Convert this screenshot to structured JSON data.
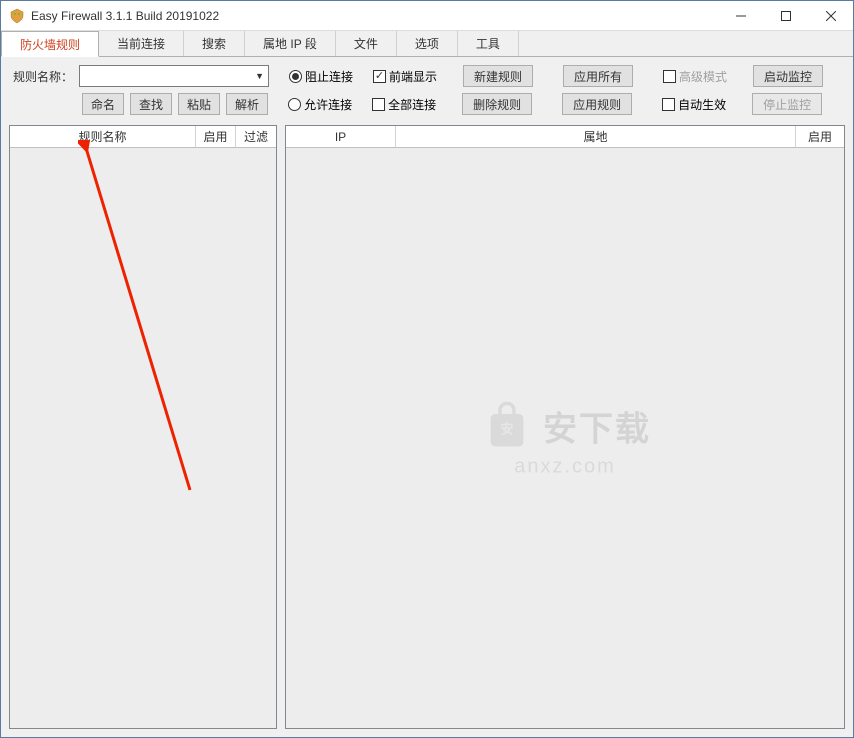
{
  "window": {
    "title": "Easy Firewall 3.1.1 Build 20191022"
  },
  "tabs": {
    "items": [
      {
        "label": "防火墙规则",
        "active": true
      },
      {
        "label": "当前连接",
        "active": false
      },
      {
        "label": "搜索",
        "active": false
      },
      {
        "label": "属地 IP 段",
        "active": false
      },
      {
        "label": "文件",
        "active": false
      },
      {
        "label": "选项",
        "active": false
      },
      {
        "label": "工具",
        "active": false
      }
    ]
  },
  "toolbar": {
    "rule_name_label": "规则名称：",
    "buttons": {
      "rename": "命名",
      "find": "查找",
      "paste": "粘贴",
      "parse": "解析",
      "new_rule": "新建规则",
      "apply_all": "应用所有",
      "advanced_mode": "高级模式",
      "start_monitor": "启动监控",
      "delete_rule": "删除规则",
      "apply_rule": "应用规则",
      "stop_monitor": "停止监控"
    },
    "radios": {
      "block_conn": "阻止连接",
      "allow_conn": "允许连接"
    },
    "checks": {
      "front_display": "前端显示",
      "all_conn": "全部连接",
      "auto_effect": "自动生效"
    }
  },
  "left_panel": {
    "headers": {
      "rule_name": "规则名称",
      "enable": "启用",
      "filter": "过滤"
    }
  },
  "right_panel": {
    "headers": {
      "ip": "IP",
      "location": "属地",
      "enable": "启用"
    }
  },
  "watermark": {
    "brand": "安下载",
    "url": "anxz.com"
  }
}
